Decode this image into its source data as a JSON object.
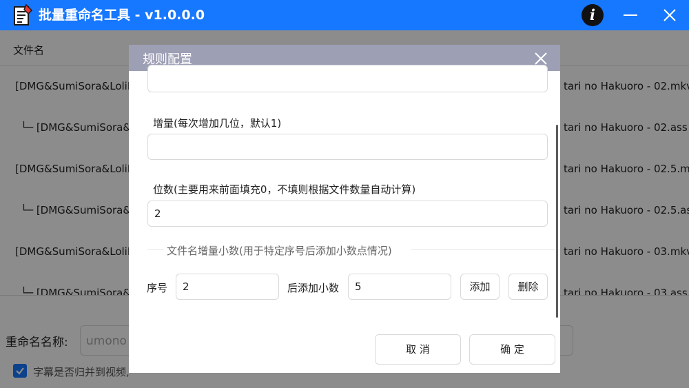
{
  "app": {
    "title": "批量重命名工具 - v1.0.0.0"
  },
  "list": {
    "header": "文件名",
    "rows": [
      {
        "left": "[DMG&SumiSora&LoliH",
        "right": "tari no Hakuoro - 02.mkv"
      },
      {
        "left": "└─ [DMG&SumiSora&",
        "right": "tari no Hakuoro - 02.ass"
      },
      {
        "left": "[DMG&SumiSora&LoliH",
        "right": "tari no Hakuoro - 02.5.mkv"
      },
      {
        "left": "└─ [DMG&SumiSora&",
        "right": "tari no Hakuoro - 02.5.ass"
      },
      {
        "left": "[DMG&SumiSora&LoliH",
        "right": "tari no Hakuoro - 03.mkv"
      },
      {
        "left": "└─ [DMG&SumiSora&",
        "right": "tari no Hakuoro - 03.ass"
      }
    ]
  },
  "bottom": {
    "rename_label": "重命名名称:",
    "rename_value": "umono",
    "merge_label": "字幕是否归并到视频,",
    "merge_checked": true
  },
  "dialog": {
    "title": "规则配置",
    "increment_label": "增量(每次增加几位，默认1)",
    "increment_value": "",
    "digits_label": "位数(主要用来前面填充0，不填则根据文件数量自动计算)",
    "digits_value": "2",
    "decimal_section_title": "文件名增量小数(用于特定序号后添加小数点情况)",
    "seq_label": "序号",
    "seq_value": "2",
    "decimal_label": "后添加小数",
    "decimal_value": "5",
    "add_button": "添加",
    "delete_button": "删除",
    "cancel_button": "取 消",
    "confirm_button": "确 定"
  },
  "colors": {
    "titlebar": "#1677ff",
    "dialog_header": "#9d9fb5",
    "checkbox": "#1677ff"
  }
}
